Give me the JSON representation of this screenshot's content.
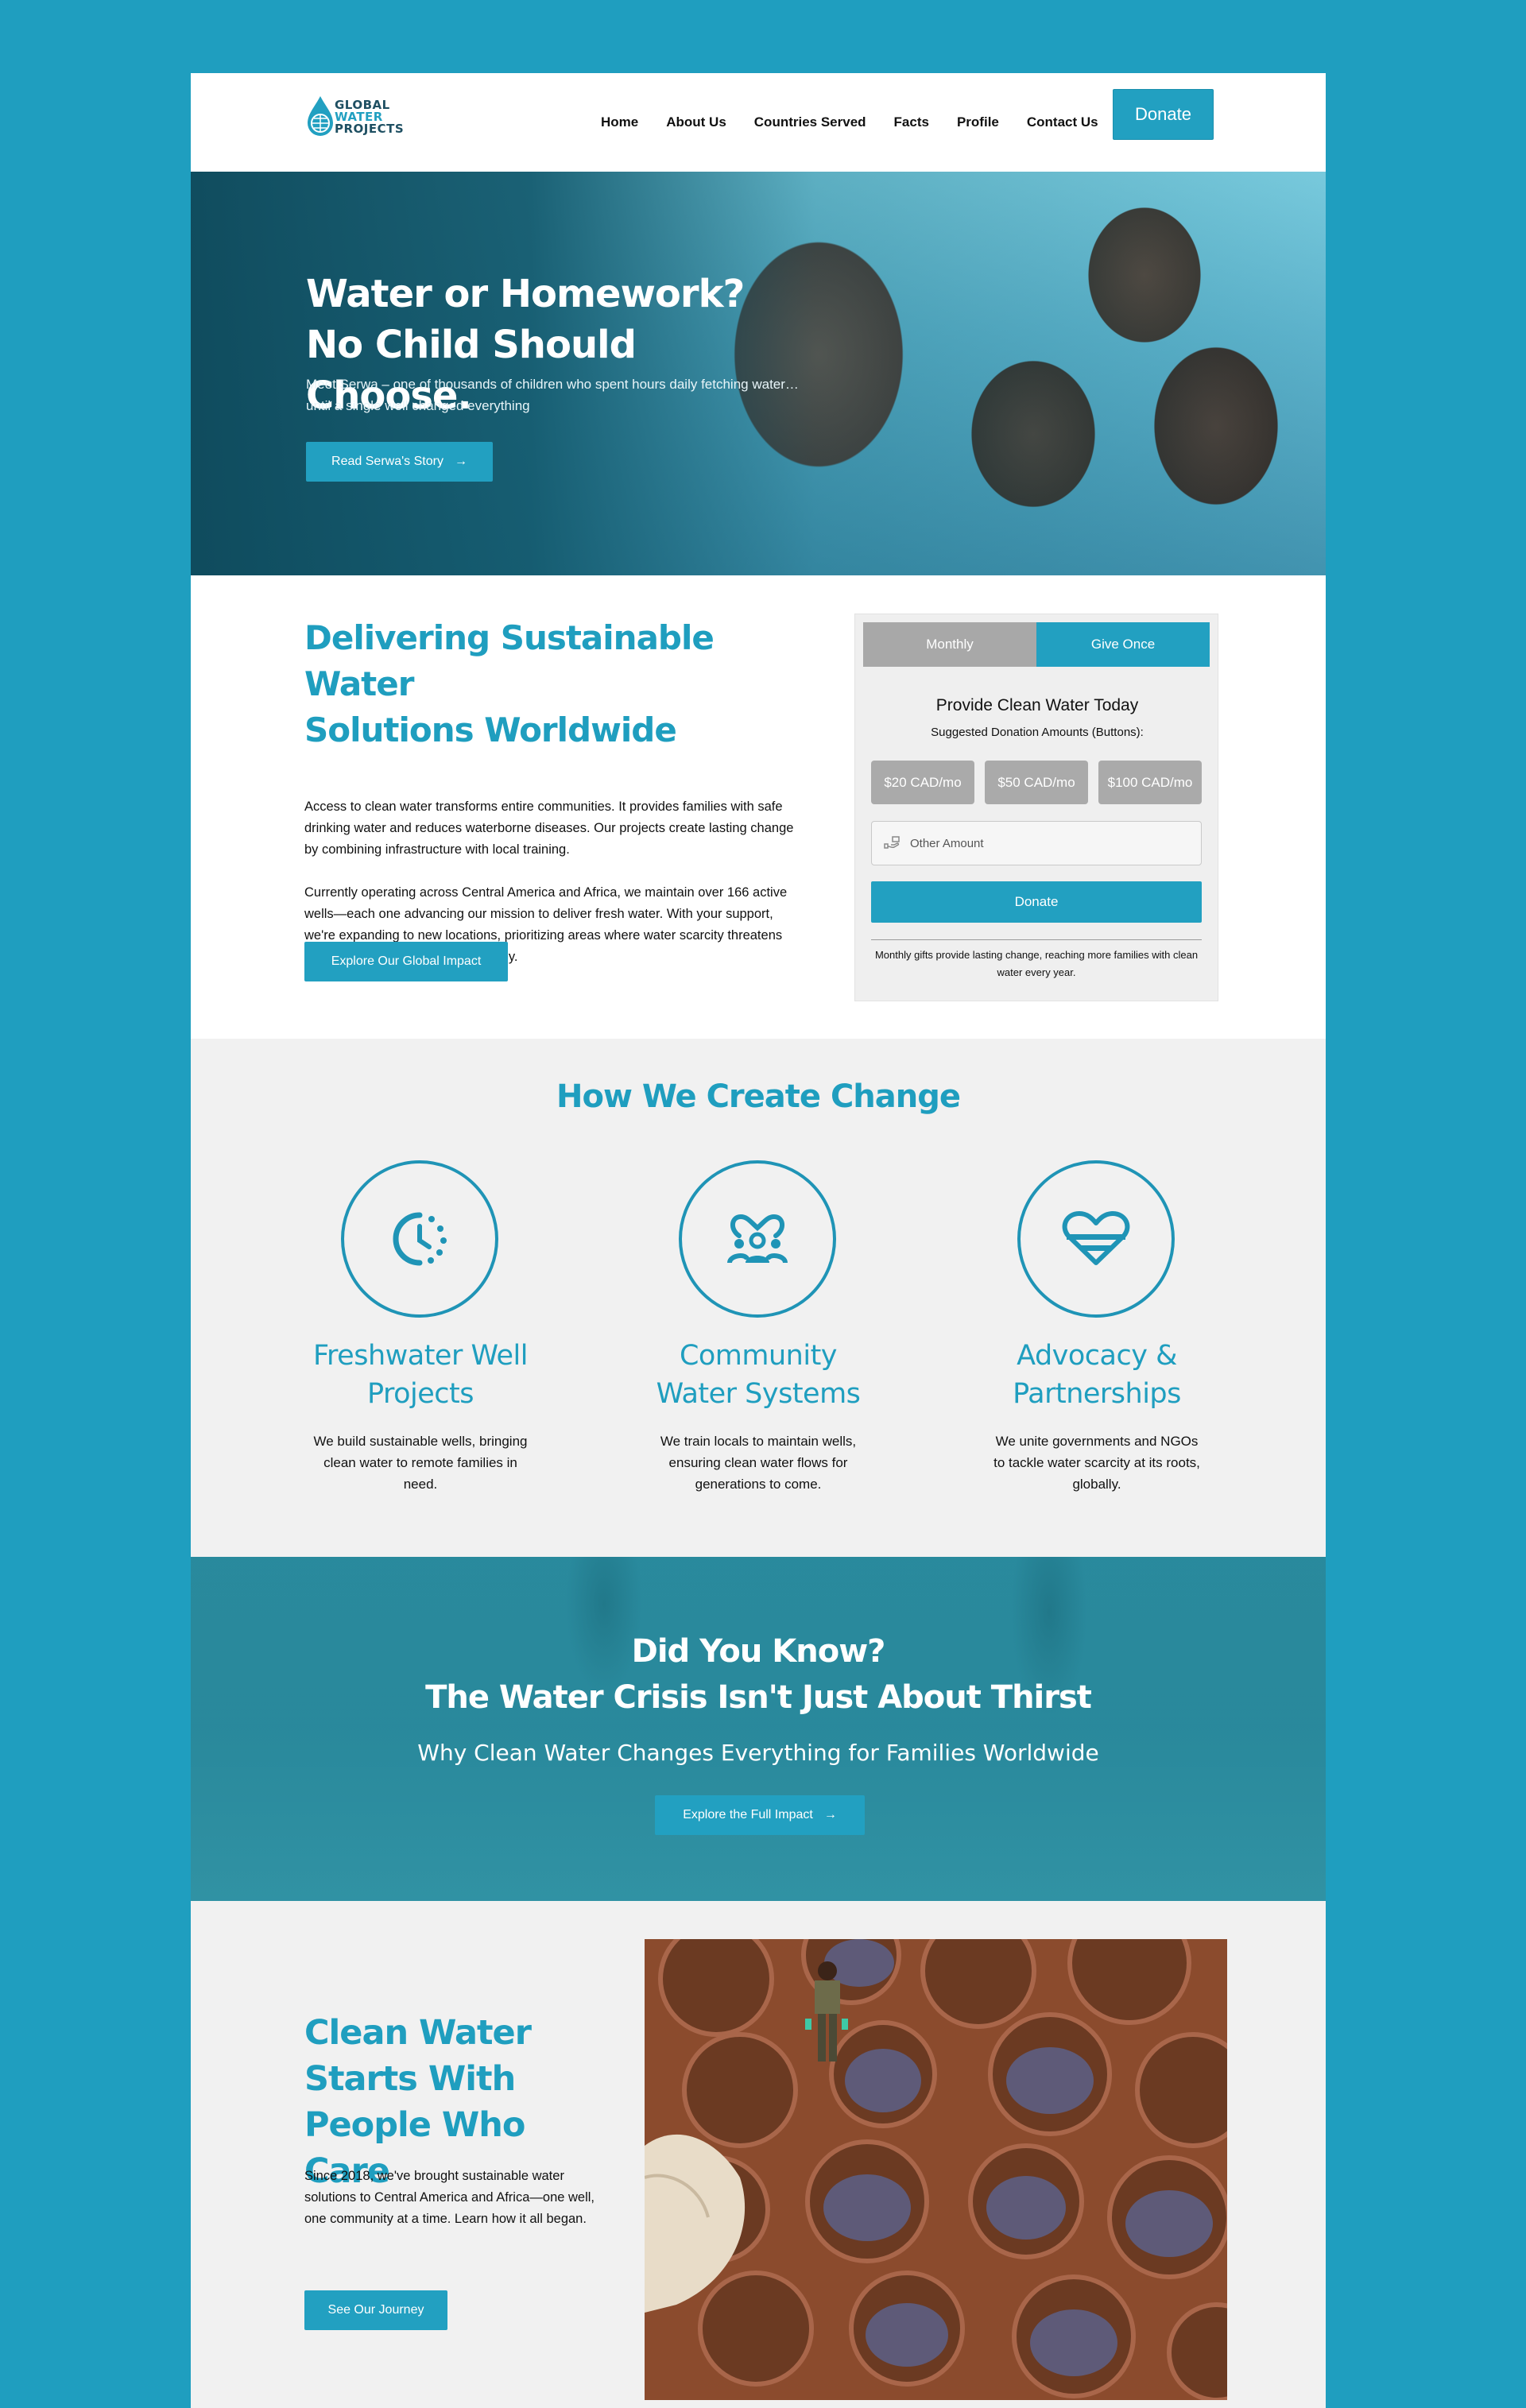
{
  "header": {
    "logo_text": [
      "GLOBAL",
      "WATER",
      "PROJECTS"
    ],
    "nav": [
      "Home",
      "About Us",
      "Countries Served",
      "Facts",
      "Profile",
      "Contact Us"
    ],
    "donate_label": "Donate"
  },
  "hero": {
    "title_line1": "Water or Homework?",
    "title_line2": "No Child Should Choose.",
    "subtitle": "Meet Serwa – one of thousands of children who spent hours daily fetching water… until a single well changed everything",
    "button": "Read Serwa's Story",
    "arrow": "→"
  },
  "intro": {
    "title_line1": "Delivering Sustainable Water",
    "title_line2": "Solutions Worldwide",
    "paragraph1": "Access to clean water transforms entire communities. It provides families with safe drinking water and reduces waterborne diseases. Our projects create lasting change by combining infrastructure with local training.",
    "paragraph2": "Currently operating across Central America and Africa, we maintain over 166 active wells—each one advancing our mission to deliver fresh water. With your support, we're expanding to new locations, prioritizing areas where water scarcity threatens health and livelihoods most severely.",
    "button": "Explore Our Global Impact"
  },
  "donation": {
    "tab_monthly": "Monthly",
    "tab_once": "Give Once",
    "title": "Provide Clean Water Today",
    "subtitle": "Suggested Donation Amounts (Buttons):",
    "amounts": [
      "$20 CAD/mo",
      "$50 CAD/mo",
      "$100 CAD/mo"
    ],
    "other_placeholder": "Other Amount",
    "donate_button": "Donate",
    "note": "Monthly gifts provide lasting change, reaching more families with clean water every year."
  },
  "change": {
    "title": "How We Create Change",
    "features": [
      {
        "icon": "clock-icon",
        "title": "Freshwater Well Projects",
        "desc": "We build sustainable wells, bringing clean water to remote families in need."
      },
      {
        "icon": "community-icon",
        "title": "Community Water Systems",
        "desc": "We train locals to maintain wells, ensuring clean water flows for generations to come."
      },
      {
        "icon": "heart-icon",
        "title": "Advocacy & Partnerships",
        "desc": "We unite governments and NGOs to tackle water scarcity at its roots, globally."
      }
    ]
  },
  "did_you_know": {
    "title_line1": "Did You Know?",
    "title_line2": "The Water Crisis Isn't Just About Thirst",
    "subtitle": "Why Clean Water Changes Everything for Families Worldwide",
    "button": "Explore the Full Impact",
    "arrow": "→"
  },
  "care": {
    "title_line1": "Clean Water",
    "title_line2": "Starts With",
    "title_line3": "People Who Care",
    "paragraph": "Since 2018, we've brought sustainable water solutions to Central America and Africa—one well, one community at a time. Learn how it all began.",
    "button": "See Our Journey"
  },
  "colors": {
    "brand": "#22a0c1",
    "background": "#1f9ebf",
    "dark_teal": "#0e4a5c",
    "section_gray": "#f1f1f1"
  }
}
